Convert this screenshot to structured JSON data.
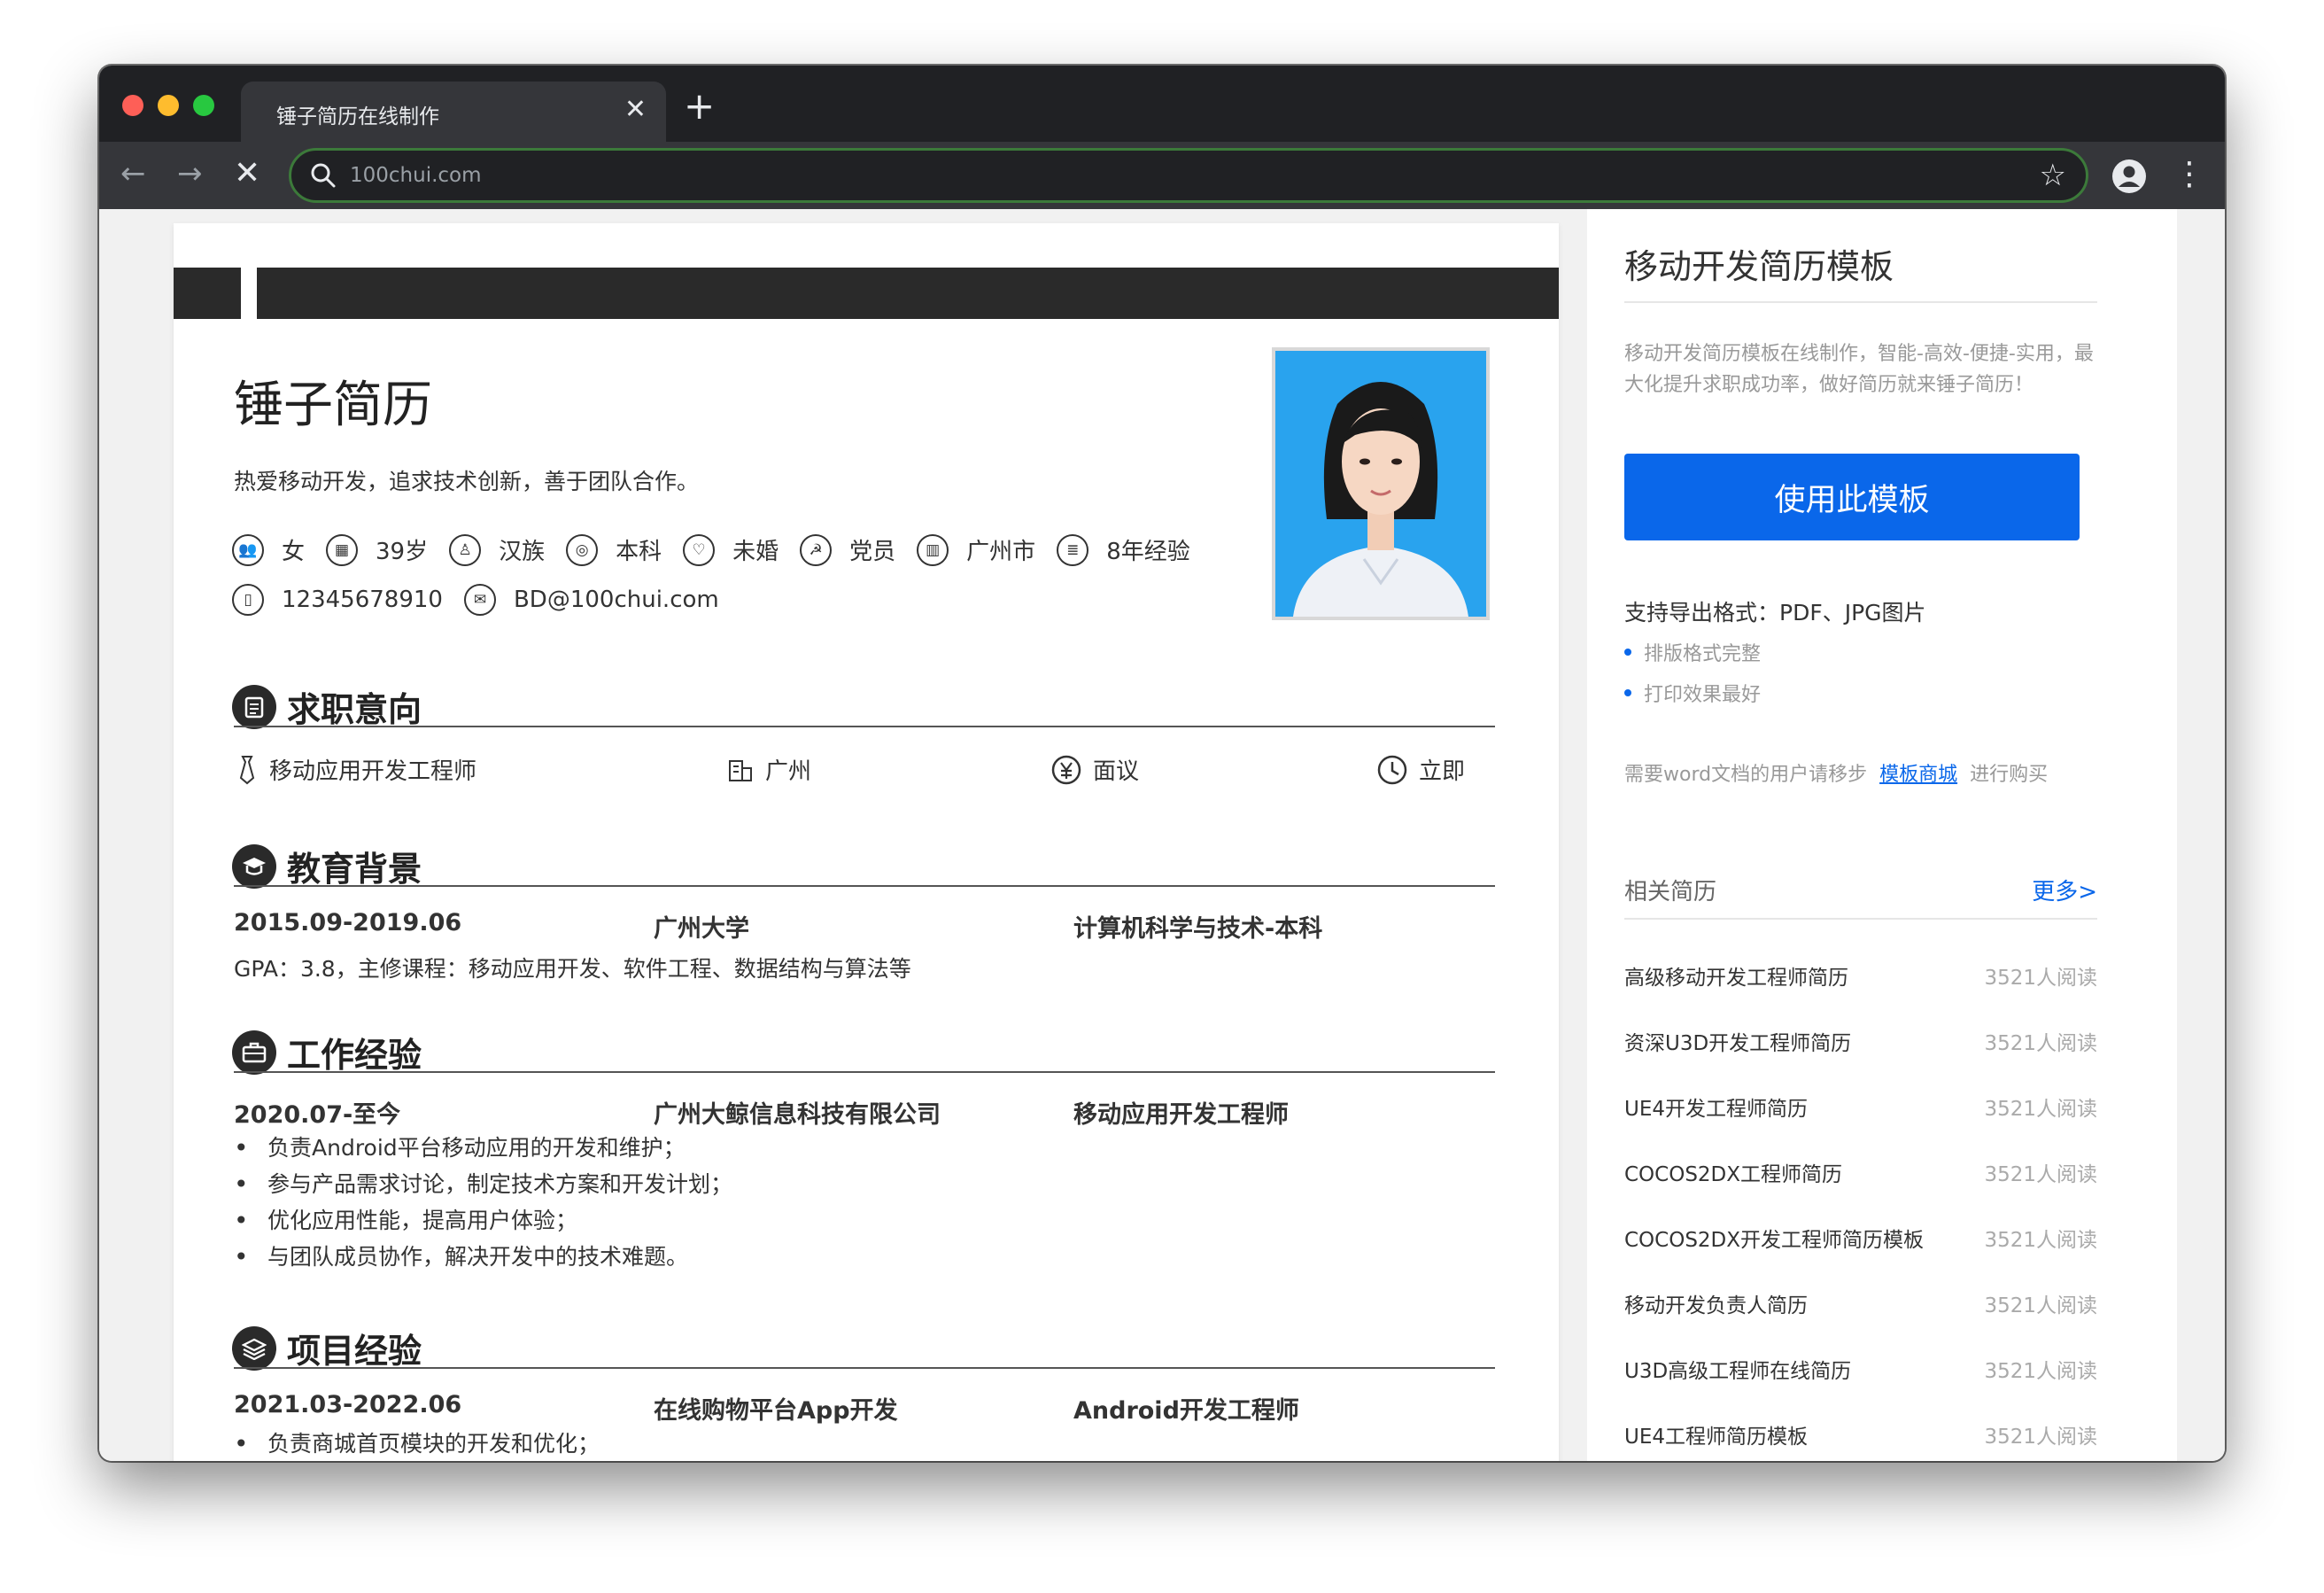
{
  "browser": {
    "tab_title": "锤子简历在线制作",
    "tab_close": "✕",
    "new_tab": "+",
    "url": "100chui.com",
    "back": "←",
    "forward": "→",
    "stop": "✕",
    "star": "☆",
    "menu": "⋮"
  },
  "resume": {
    "name": "锤子简历",
    "tagline": "热爱移动开发，追求技术创新，善于团队合作。",
    "info": {
      "gender": "女",
      "age": "39岁",
      "ethnicity": "汉族",
      "degree": "本科",
      "marital": "未婚",
      "political": "党员",
      "city": "广州市",
      "experience": "8年经验",
      "phone": "12345678910",
      "email": "BD@100chui.com"
    },
    "sections": {
      "intent": "求职意向",
      "education": "教育背景",
      "work": "工作经验",
      "project": "项目经验"
    },
    "intent": {
      "position": "移动应用开发工程师",
      "city": "广州",
      "salary": "面议",
      "start": "立即"
    },
    "education": {
      "period": "2015.09-2019.06",
      "school": "广州大学",
      "major": "计算机科学与技术-本科",
      "detail": "GPA：3.8，主修课程：移动应用开发、软件工程、数据结构与算法等"
    },
    "work": {
      "period": "2020.07-至今",
      "company": "广州大鲸信息科技有限公司",
      "role": "移动应用开发工程师",
      "bullets": [
        "负责Android平台移动应用的开发和维护；",
        "参与产品需求讨论，制定技术方案和开发计划；",
        "优化应用性能，提高用户体验；",
        "与团队成员协作，解决开发中的技术难题。"
      ]
    },
    "project": {
      "period": "2021.03-2022.06",
      "name": "在线购物平台App开发",
      "role": "Android开发工程师",
      "bullets": [
        "负责商城首页模块的开发和优化；"
      ]
    }
  },
  "sidebar": {
    "title": "移动开发简历模板",
    "description": "移动开发简历模板在线制作，智能-高效-便捷-实用，最大化提升求职成功率，做好简历就来锤子简历！",
    "use_button": "使用此模板",
    "formats": "支持导出格式：PDF、JPG图片",
    "points": [
      "排版格式完整",
      "打印效果最好"
    ],
    "word_prefix": "需要word文档的用户请移步",
    "word_link": "模板商城",
    "word_suffix": "进行购买",
    "related_title": "相关简历",
    "more": "更多>",
    "related": [
      {
        "title": "高级移动开发工程师简历",
        "reads": "3521人阅读"
      },
      {
        "title": "资深U3D开发工程师简历",
        "reads": "3521人阅读"
      },
      {
        "title": "UE4开发工程师简历",
        "reads": "3521人阅读"
      },
      {
        "title": "COCOS2DX工程师简历",
        "reads": "3521人阅读"
      },
      {
        "title": "COCOS2DX开发工程师简历模板",
        "reads": "3521人阅读"
      },
      {
        "title": "移动开发负责人简历",
        "reads": "3521人阅读"
      },
      {
        "title": "U3D高级工程师在线简历",
        "reads": "3521人阅读"
      },
      {
        "title": "UE4工程师简历模板",
        "reads": "3521人阅读"
      }
    ]
  }
}
